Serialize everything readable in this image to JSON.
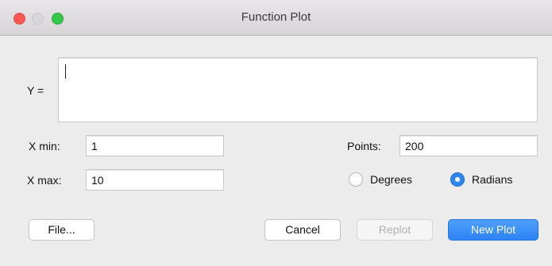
{
  "window": {
    "title": "Function Plot"
  },
  "form": {
    "y_label": "Y =",
    "y_value": "",
    "xmin_label": "X min:",
    "xmin_value": "1",
    "xmax_label": "X max:",
    "xmax_value": "10",
    "points_label": "Points:",
    "points_value": "200"
  },
  "angle_units": {
    "options": [
      "Degrees",
      "Radians"
    ],
    "selected": "Radians"
  },
  "buttons": {
    "file": "File...",
    "cancel": "Cancel",
    "replot": "Replot",
    "new_plot": "New Plot"
  },
  "colors": {
    "close": "#fc5753",
    "zoom": "#34c84a",
    "accent": "#2e86f5"
  }
}
